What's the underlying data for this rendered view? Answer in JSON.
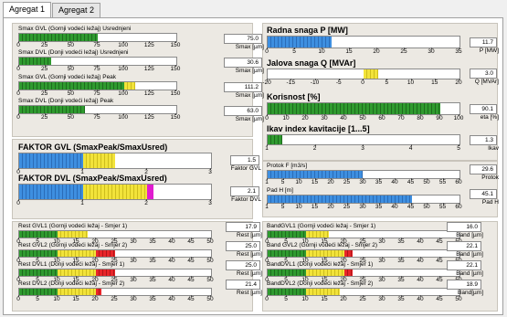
{
  "tabs": [
    "Agregat 1",
    "Agregat 2"
  ],
  "left_gauges": [
    {
      "title": "Smax GVL (Gornji vodeći ležaj) Usrednjeni",
      "value": "75.0",
      "unit": "Smax [µm]",
      "fill": 0.5
    },
    {
      "title": "Smax DVL (Donji vodeći ležaj) Usrednjeni",
      "value": "30.6",
      "unit": "Smax [µm]",
      "fill": 0.204
    },
    {
      "title": "Smax GVL (Gornji vodeći ležaj) Peak",
      "value": "111.2",
      "unit": "Smax [µm]",
      "fill": 0.741
    },
    {
      "title": "Smax DVL (Donji vodeći ležaj) Peak",
      "value": "63.0",
      "unit": "Smax [µm]",
      "fill": 0.42
    }
  ],
  "left_ticks": [
    "0",
    "25",
    "50",
    "75",
    "100",
    "125",
    "150"
  ],
  "faktor": [
    {
      "title": "FAKTOR GVL (SmaxPeak/SmaxUsred)",
      "value": "1.5",
      "unit": "Faktor GVL",
      "fill": 0.5
    },
    {
      "title": "FAKTOR DVL (SmaxPeak/SmaxUsred)",
      "value": "2.1",
      "unit": "Faktor DVL",
      "fill": 0.7
    }
  ],
  "faktor_ticks": [
    "0",
    "1",
    "2",
    "3"
  ],
  "rest_gauges": [
    {
      "title": "Rest GVL1 (Gornji vodeći ležaj - Smjer 1)",
      "value": "17.9",
      "unit": "Rest [µm]",
      "fill": 0.358
    },
    {
      "title": "Rest GVL2 (Gornji vodeći ležaj - Smjer 2)",
      "value": "25.0",
      "unit": "Rest [µm]",
      "fill": 0.5
    },
    {
      "title": "Rest DVL1 (Donji vodeći ležaj - Smjer 1)",
      "value": "25.0",
      "unit": "Rest [µm]",
      "fill": 0.5
    },
    {
      "title": "Rest DVL2 (Donji vodeći ležaj - Smjer 2)",
      "value": "21.4",
      "unit": "Rest [µm]",
      "fill": 0.428
    }
  ],
  "band_gauges": [
    {
      "title": "BandGVL1 (Gornji vodeći ležaj - Smjer 1)",
      "value": "16.0",
      "unit": "Band [µm]",
      "fill": 0.32
    },
    {
      "title": "Band GVL2 (Gornji vodeći ležaj - Smjer 2)",
      "value": "22.1",
      "unit": "Band [µm]",
      "fill": 0.442
    },
    {
      "title": "BandDVL1 (Donji vodeći ležaj - Smjer 1)",
      "value": "22.1",
      "unit": "Band [µm]",
      "fill": 0.442
    },
    {
      "title": "BandDVL2 (Donji vodeći ležaj - Smjer 2)",
      "value": "18.9",
      "unit": "Band[µm]",
      "fill": 0.378
    }
  ],
  "rb_ticks": [
    "0",
    "5",
    "10",
    "15",
    "20",
    "25",
    "30",
    "35",
    "40",
    "45",
    "50"
  ],
  "radna": {
    "title": "Radna snaga P [MW]",
    "value": "11.7",
    "unit": "P [MW]",
    "fill": 0.334,
    "ticks": [
      "0",
      "5",
      "10",
      "15",
      "20",
      "25",
      "30",
      "35"
    ]
  },
  "jalova": {
    "title": "Jalova snaga Q [MVAr]",
    "value": "3.0",
    "unit": "Q [MVAr]",
    "fill_from": 0.5,
    "fill_to": 0.575,
    "ticks": [
      "-20",
      "-15",
      "-10",
      "-5",
      "0",
      "5",
      "10",
      "15",
      "20"
    ]
  },
  "korisnost": {
    "title": "Korisnost [%]",
    "value": "90.1",
    "unit": "eta [%]",
    "fill": 0.901,
    "ticks": [
      "0",
      "10",
      "20",
      "30",
      "40",
      "50",
      "60",
      "70",
      "80",
      "90",
      "100"
    ]
  },
  "ikav": {
    "title": "Ikav index kavitacije [1...5]",
    "value": "1.3",
    "unit": "Ikav",
    "fill": 0.075,
    "ticks": [
      "1",
      "2",
      "3",
      "4",
      "5"
    ]
  },
  "protok": {
    "title": "Protok F [m3/s]",
    "value": "29.6",
    "unit": "Protok",
    "fill": 0.493,
    "ticks": [
      "1",
      "5",
      "10",
      "15",
      "20",
      "25",
      "30",
      "35",
      "40",
      "45",
      "50",
      "55",
      "60"
    ]
  },
  "pad": {
    "title": "Pad H [m]",
    "value": "45.1",
    "unit": "Pad H",
    "fill": 0.752,
    "ticks": [
      "1",
      "5",
      "10",
      "15",
      "20",
      "25",
      "30",
      "35",
      "40",
      "45",
      "50",
      "55",
      "60"
    ]
  }
}
